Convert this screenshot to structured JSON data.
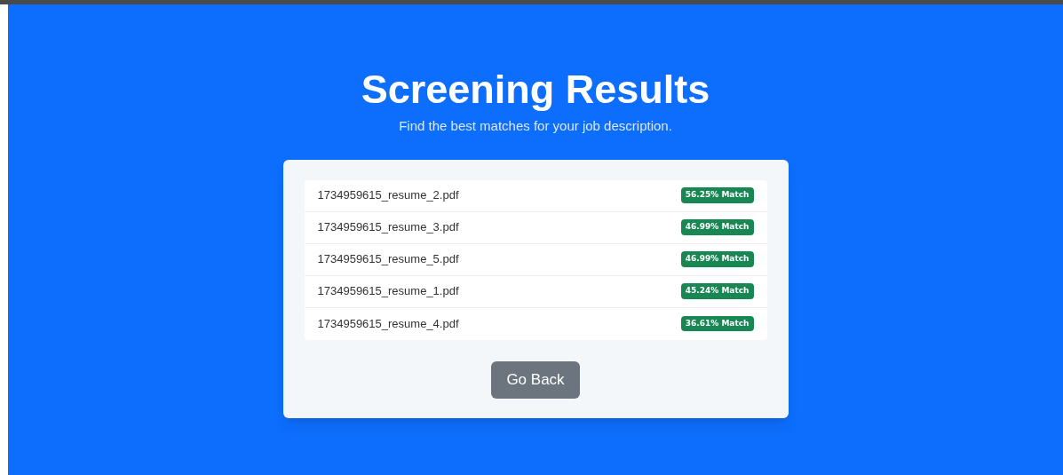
{
  "title": "Screening Results",
  "subtitle": "Find the best matches for your job description.",
  "results": [
    {
      "file": "1734959615_resume_2.pdf",
      "match": "56.25% Match"
    },
    {
      "file": "1734959615_resume_3.pdf",
      "match": "46.99% Match"
    },
    {
      "file": "1734959615_resume_5.pdf",
      "match": "46.99% Match"
    },
    {
      "file": "1734959615_resume_1.pdf",
      "match": "45.24% Match"
    },
    {
      "file": "1734959615_resume_4.pdf",
      "match": "36.61% Match"
    }
  ],
  "button": "Go Back"
}
